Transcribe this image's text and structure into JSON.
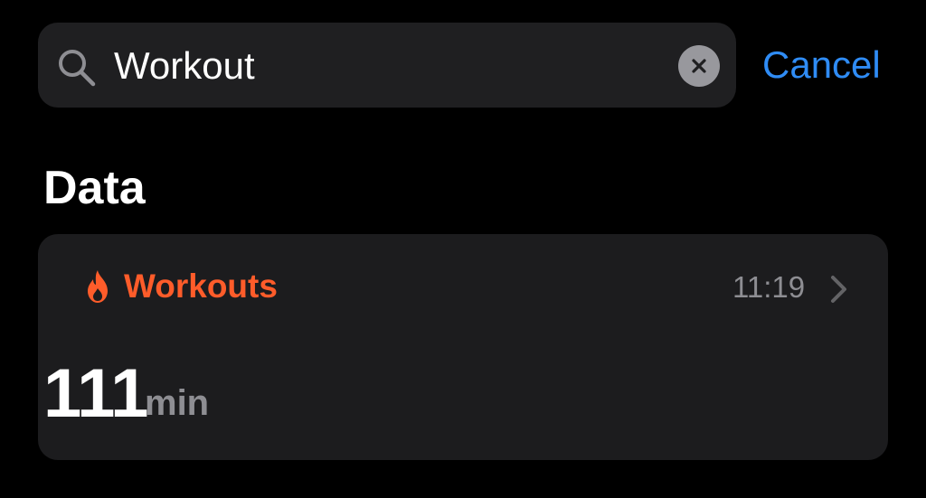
{
  "search": {
    "value": "Workout",
    "icon": "search-icon",
    "clear_icon": "clear-icon"
  },
  "cancel_label": "Cancel",
  "section": {
    "title": "Data"
  },
  "card": {
    "icon": "flame-icon",
    "category": "Workouts",
    "time": "11:19",
    "value": "111",
    "unit": "min",
    "chevron": "chevron-right-icon"
  },
  "colors": {
    "background": "#000000",
    "search_bar": "#1f1f21",
    "card": "#1c1c1e",
    "accent_blue": "#2f8cf5",
    "workout_orange": "#fe5c2a",
    "secondary_text": "#8e8e93"
  }
}
